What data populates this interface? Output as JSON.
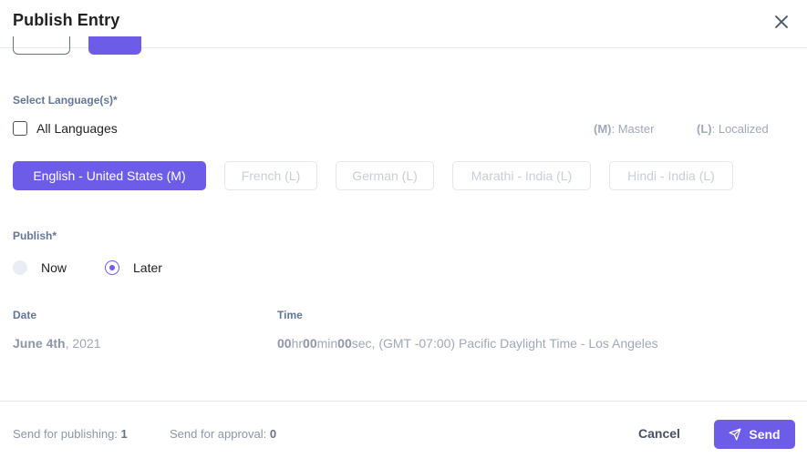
{
  "modal": {
    "title": "Publish Entry",
    "close_icon": "close-icon"
  },
  "languages_section": {
    "label": "Select Language(s)*",
    "all_languages_label": "All Languages",
    "all_languages_checked": false,
    "legend": {
      "master_key": "(M)",
      "master_text": ": Master",
      "localized_key": "(L)",
      "localized_text": ": Localized"
    },
    "options": [
      {
        "label": "English - United States (M)",
        "selected": true
      },
      {
        "label": "French (L)",
        "selected": false
      },
      {
        "label": "German (L)",
        "selected": false
      },
      {
        "label": "Marathi - India (L)",
        "selected": false
      },
      {
        "label": "Hindi - India (L)",
        "selected": false
      }
    ]
  },
  "publish_section": {
    "label": "Publish*",
    "options": [
      {
        "label": "Now",
        "selected": false
      },
      {
        "label": "Later",
        "selected": true
      }
    ]
  },
  "schedule": {
    "date_label": "Date",
    "date_bold": "June 4th",
    "date_rest": ", 2021",
    "time_label": "Time",
    "hours": "00",
    "hours_unit": "hr",
    "minutes": "00",
    "minutes_unit": "min",
    "seconds": "00",
    "seconds_unit": "sec",
    "timezone": ", (GMT -07:00) Pacific Daylight Time - Los Angeles"
  },
  "footer": {
    "publishing_label": "Send for publishing: ",
    "publishing_count": "1",
    "approval_label": "Send for approval: ",
    "approval_count": "0",
    "cancel_label": "Cancel",
    "send_label": "Send",
    "send_icon": "send-icon"
  },
  "colors": {
    "accent": "#6c5ce7",
    "muted": "#a0a8b8",
    "label": "#647696"
  }
}
